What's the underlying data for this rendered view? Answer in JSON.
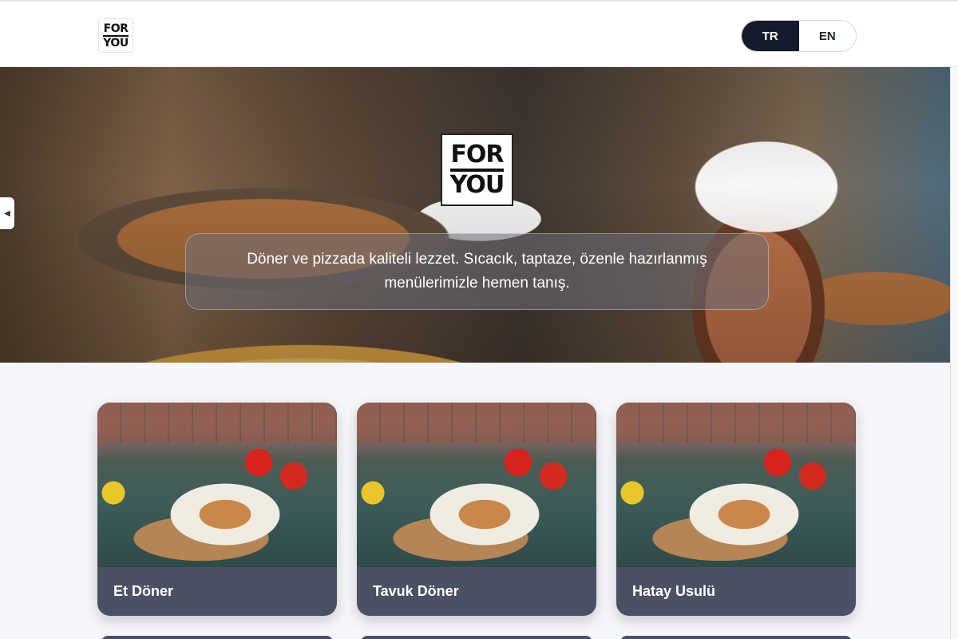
{
  "header": {
    "logo_top": "FOR",
    "logo_bottom": "YOU",
    "languages": [
      {
        "label": "TR",
        "active": true
      },
      {
        "label": "EN",
        "active": false
      }
    ]
  },
  "hero": {
    "logo_top": "FOR",
    "logo_bottom": "YOU",
    "caption": "Döner ve pizzada kaliteli lezzet. Sıcacık, taptaze, özenle hazırlanmış menülerimizle hemen tanış.",
    "side_toggle_icon": "chevron-left-icon"
  },
  "menu": {
    "categories": [
      {
        "title": "Et Döner"
      },
      {
        "title": "Tavuk Döner"
      },
      {
        "title": "Hatay Usulü"
      }
    ]
  }
}
